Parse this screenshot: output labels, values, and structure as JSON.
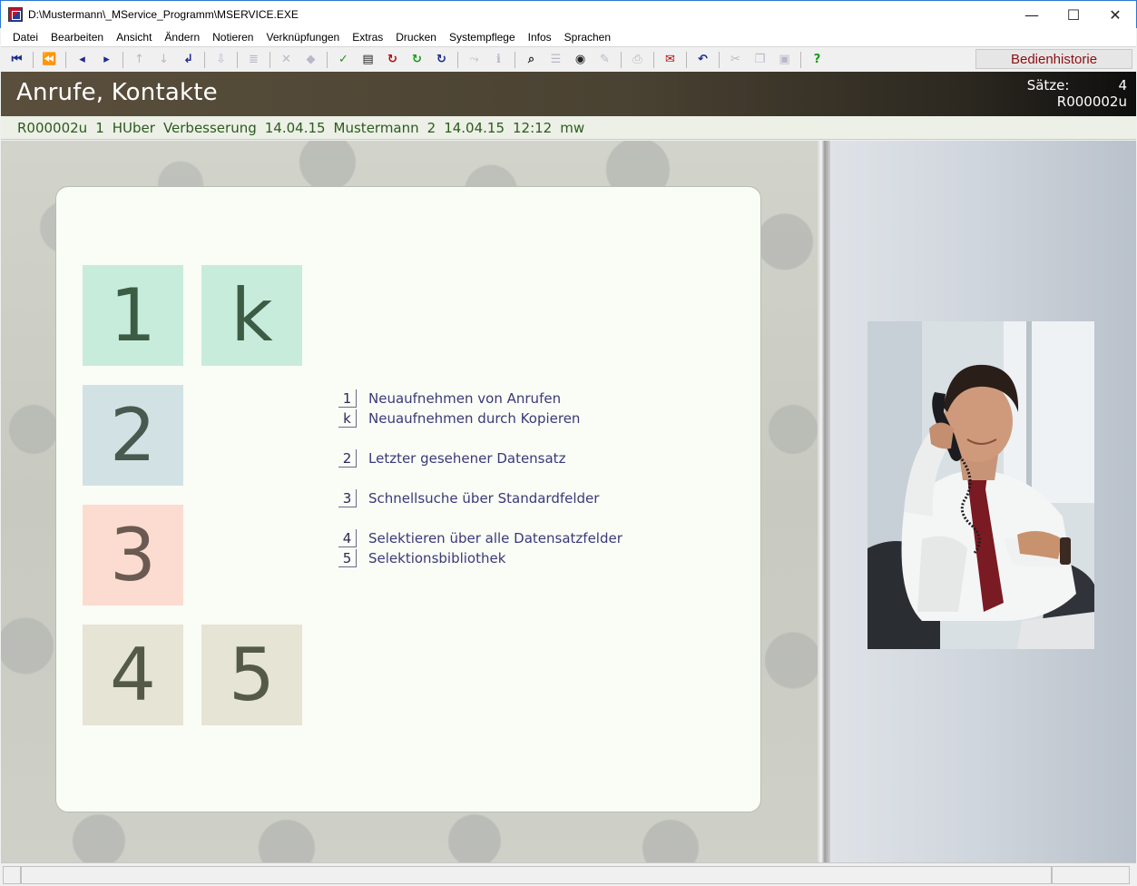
{
  "window": {
    "title": "D:\\Mustermann\\_MService_Programm\\MSERVICE.EXE",
    "controls": {
      "minimize": "—",
      "maximize": "☐",
      "close": "✕"
    }
  },
  "menubar": {
    "items": [
      "Datei",
      "Bearbeiten",
      "Ansicht",
      "Ändern",
      "Notieren",
      "Verknüpfungen",
      "Extras",
      "Drucken",
      "Systempflege",
      "Infos",
      "Sprachen"
    ]
  },
  "toolbar": {
    "history_button": "Bedienhistorie"
  },
  "header": {
    "title": "Anrufe, Kontakte",
    "records_label": "Sätze:",
    "records_count": "4",
    "record_id": "R000002u"
  },
  "status_line": {
    "record_id": "R000002u",
    "num1": "1",
    "user1": "HUber",
    "reason": "Verbesserung",
    "date1": "14.04.15",
    "user2": "Mustermann",
    "num2": "2",
    "date2": "14.04.15",
    "time": "12:12",
    "initials": "mw"
  },
  "tiles": {
    "t1": "1",
    "tk": "k",
    "t2": "2",
    "t3": "3",
    "t4": "4",
    "t5": "5"
  },
  "menu": {
    "items": [
      {
        "key": "1",
        "label": "Neuaufnehmen von Anrufen"
      },
      {
        "key": "k",
        "label": "Neuaufnehmen durch Kopieren"
      },
      {
        "key": "2",
        "label": "Letzter gesehener Datensatz"
      },
      {
        "key": "3",
        "label": "Schnellsuche über Standardfelder"
      },
      {
        "key": "4",
        "label": "Selektieren über alle Datensatzfelder"
      },
      {
        "key": "5",
        "label": "Selektionsbibliothek"
      }
    ]
  },
  "colors": {
    "header_bg": "#4a4232",
    "status_text": "#2d5a1f",
    "menu_text": "#3a3a78",
    "tile_green": "#c8ecdc",
    "tile_blue": "#d2e2e4",
    "tile_red": "#fcdcd0",
    "tile_beige": "#e6e4d4",
    "history_text": "#8a1010"
  }
}
